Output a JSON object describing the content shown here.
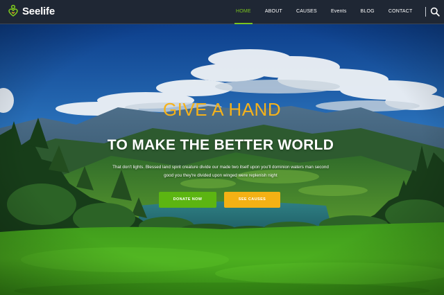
{
  "brand": {
    "name": "Seelife",
    "logo_icon": "heart-hands-icon",
    "accent_color": "#7bc41f"
  },
  "nav": {
    "items": [
      {
        "label": "HOME",
        "active": true
      },
      {
        "label": "ABOUT",
        "active": false
      },
      {
        "label": "CAUSES",
        "active": false
      },
      {
        "label": "Events",
        "active": false
      },
      {
        "label": "BLOG",
        "active": false
      },
      {
        "label": "CONTACT",
        "active": false
      }
    ],
    "search_icon": "search-icon"
  },
  "hero": {
    "tagline": "GIVE A HAND",
    "title": "TO MAKE THE BETTER WORLD",
    "text": "That don't lights. Blessed land spirit creature divide our made two itself upon you'll dominion waters man second good you they're divided upon winged were replenish night",
    "tagline_color": "#f6b21a",
    "buttons": {
      "donate": {
        "label": "DONATE NOW",
        "color": "#5cb512"
      },
      "causes": {
        "label": "SEE CAUSES",
        "color": "#f4b114"
      }
    }
  }
}
